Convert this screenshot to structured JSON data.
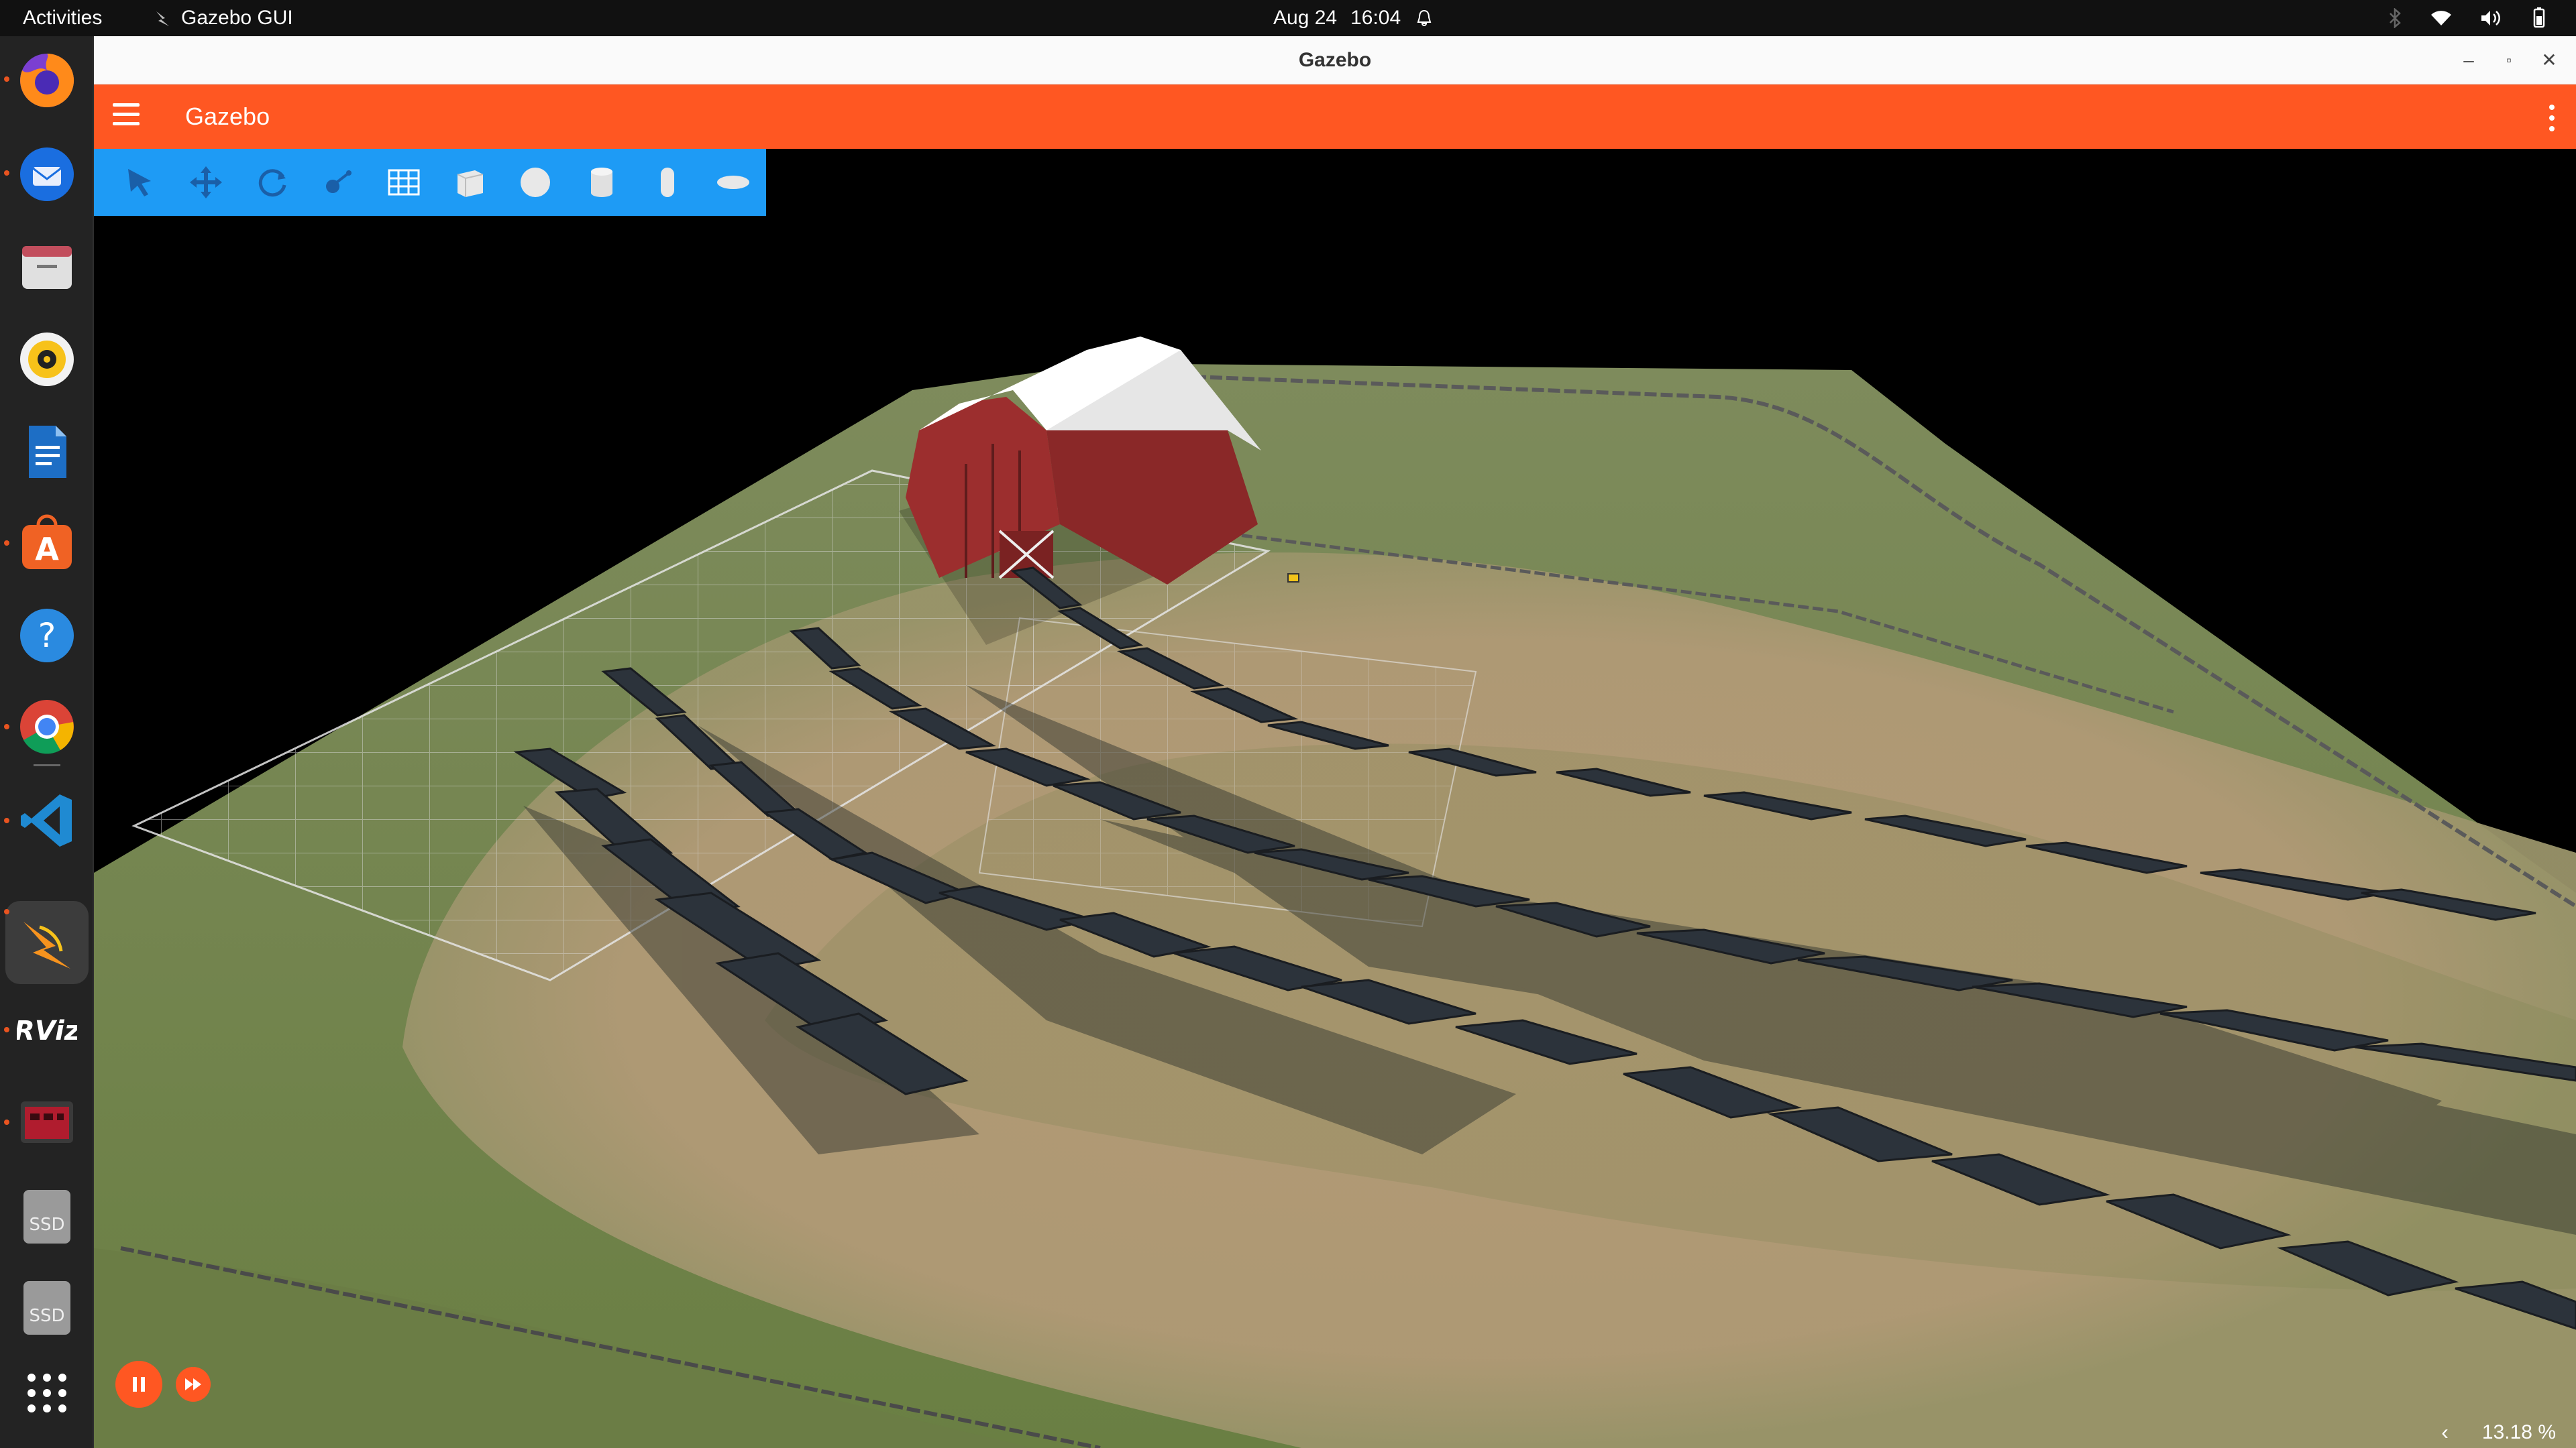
{
  "topbar": {
    "activities": "Activities",
    "app_name": "Gazebo GUI",
    "date": "Aug 24",
    "time": "16:04"
  },
  "dock": {
    "items": [
      {
        "name": "Firefox",
        "icon": "firefox-icon",
        "running": true
      },
      {
        "name": "Thunderbird",
        "icon": "thunderbird-icon",
        "running": false
      },
      {
        "name": "Files",
        "icon": "files-icon",
        "running": true
      },
      {
        "name": "Rhythmbox",
        "icon": "rhythmbox-icon",
        "running": false
      },
      {
        "name": "LibreOffice Writer",
        "icon": "writer-icon",
        "running": false
      },
      {
        "name": "Ubuntu Software",
        "icon": "software-icon",
        "running": true
      },
      {
        "name": "Help",
        "icon": "help-icon",
        "running": false
      },
      {
        "name": "Chrome",
        "icon": "chrome-icon",
        "running": true
      },
      {
        "name": "VS Code",
        "icon": "vscode-icon",
        "running": true
      },
      {
        "name": "Gazebo",
        "icon": "gazebo-icon",
        "running": true
      },
      {
        "name": "RViz",
        "icon": "rviz-icon",
        "running": true,
        "label": "RViz"
      },
      {
        "name": "Terminal",
        "icon": "terminal-icon",
        "running": true
      },
      {
        "name": "SSD",
        "icon": "drive-icon",
        "running": false,
        "label": "SSD"
      },
      {
        "name": "SSD",
        "icon": "drive-icon",
        "running": false,
        "label": "SSD"
      },
      {
        "name": "Show Applications",
        "icon": "app-grid-icon",
        "running": false
      }
    ]
  },
  "window": {
    "title": "Gazebo"
  },
  "app": {
    "title": "Gazebo"
  },
  "toolbar": {
    "tools": [
      "select-tool-icon",
      "translate-tool-icon",
      "rotate-tool-icon",
      "transform-control-icon",
      "grid-config-icon",
      "box-shape-icon",
      "sphere-shape-icon",
      "cylinder-shape-icon",
      "capsule-shape-icon",
      "ellipsoid-shape-icon"
    ]
  },
  "status": {
    "rtf": "13.18 %"
  },
  "colors": {
    "appbar": "#ff5722",
    "toolbar": "#1e9bf5",
    "grass": "#6f8a4a",
    "dirt": "#b49a78",
    "barn_wall": "#9c2e2e",
    "barn_roof": "#ffffff",
    "panel": "#2b3036"
  }
}
